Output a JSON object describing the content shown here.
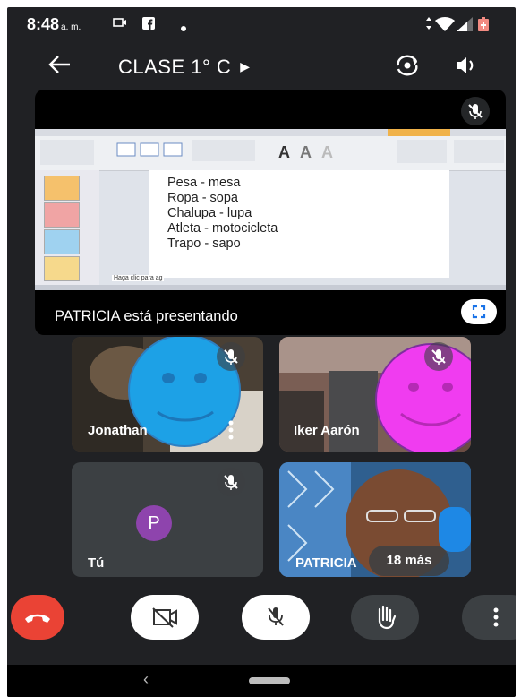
{
  "status_bar": {
    "time": "8:48",
    "ampm": "a. m."
  },
  "app_bar": {
    "title": "CLASE 1° C"
  },
  "presentation": {
    "presenter_label": "PATRICIA está presentando",
    "slide_lines": [
      "Pesa - mesa",
      "Ropa - sopa",
      "Chalupa - lupa",
      "Atleta - motocicleta",
      "Trapo - sapo"
    ],
    "slide_hint": "Haga clic para ag"
  },
  "participants": [
    {
      "name": "Jonathan"
    },
    {
      "name": "Iker Aarón"
    },
    {
      "name": "Tú",
      "initial": "P"
    },
    {
      "name": "PATRICIA"
    }
  ],
  "more_participants": "18 más",
  "colors": {
    "background": "#202124",
    "hangup": "#ea4335",
    "smiley_blue": "#1da1e6",
    "smiley_pink": "#f03cf0",
    "avatar_purple": "#8e44ad"
  }
}
